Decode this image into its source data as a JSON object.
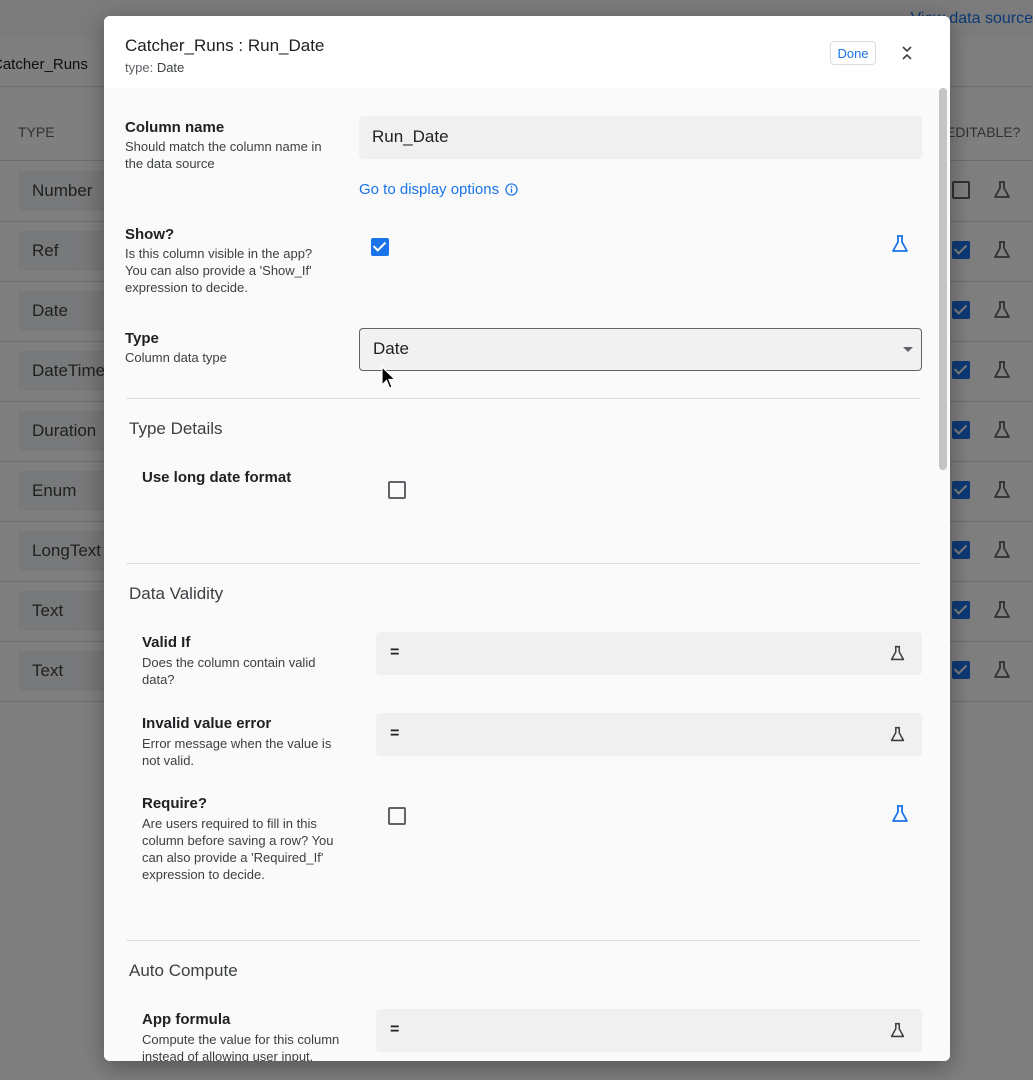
{
  "background": {
    "view_data_source": "View data source",
    "table_tab": "Catcher_Runs",
    "header_type": "TYPE",
    "header_editable": "EDITABLE?",
    "rows": [
      {
        "type": "Number",
        "editable": false
      },
      {
        "type": "Ref",
        "editable": true
      },
      {
        "type": "Date",
        "editable": true
      },
      {
        "type": "DateTime",
        "editable": true
      },
      {
        "type": "Duration",
        "editable": true
      },
      {
        "type": "Enum",
        "editable": true
      },
      {
        "type": "LongText",
        "editable": true
      },
      {
        "type": "Text",
        "editable": true
      },
      {
        "type": "Text",
        "editable": true
      }
    ]
  },
  "dialog": {
    "title": "Catcher_Runs : Run_Date",
    "subtitle_prefix": "type:",
    "subtitle_value": "Date",
    "done_label": "Done",
    "column_name": {
      "label": "Column name",
      "help": "Should match the column name in the data source",
      "value": "Run_Date",
      "display_link": "Go to display options"
    },
    "show": {
      "label": "Show?",
      "help": "Is this column visible in the app? You can also provide a 'Show_If' expression to decide.",
      "checked": true
    },
    "type": {
      "label": "Type",
      "help": "Column data type",
      "value": "Date"
    },
    "type_details": {
      "title": "Type Details",
      "long_date": {
        "label": "Use long date format",
        "checked": false
      }
    },
    "data_validity": {
      "title": "Data Validity",
      "valid_if": {
        "label": "Valid If",
        "help": "Does the column contain valid data?",
        "value": "="
      },
      "invalid_error": {
        "label": "Invalid value error",
        "help": "Error message when the value is not valid.",
        "value": "="
      },
      "require": {
        "label": "Require?",
        "help": "Are users required to fill in this column before saving a row? You can also provide a 'Required_If' expression to decide.",
        "checked": false
      }
    },
    "auto_compute": {
      "title": "Auto Compute",
      "app_formula": {
        "label": "App formula",
        "help": "Compute the value for this column instead of allowing user input.",
        "value": "="
      }
    }
  },
  "colors": {
    "accent": "#1a73e8",
    "scrim": "#000000"
  }
}
